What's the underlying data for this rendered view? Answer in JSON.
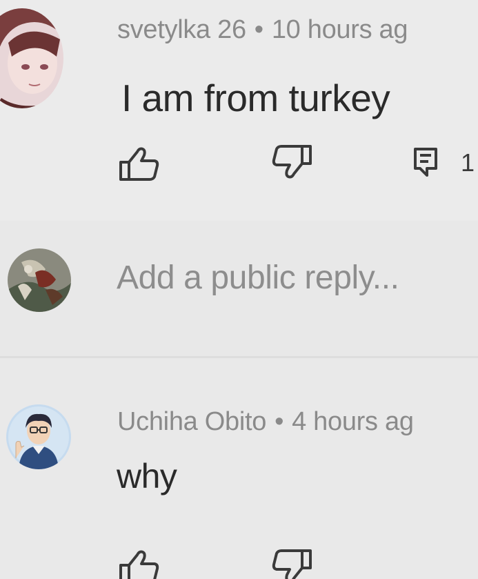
{
  "comment": {
    "author": "svetylka 26",
    "separator": "•",
    "time": "10 hours ag",
    "text": "I am from turkey",
    "reply_count": "1",
    "icons": {
      "like": "thumbs-up-icon",
      "dislike": "thumbs-down-icon",
      "reply": "reply-comment-icon"
    }
  },
  "reply_box": {
    "placeholder": "Add a public reply..."
  },
  "reply": {
    "author": "Uchiha Obito",
    "separator": "•",
    "time": "4 hours ag",
    "text": "why",
    "icons": {
      "like": "thumbs-up-icon",
      "dislike": "thumbs-down-icon"
    }
  },
  "colors": {
    "background": "#e9e9e9",
    "meta_text": "#8a8a8a",
    "body_text": "#2a2a2a",
    "icon_stroke": "#3a3a3a"
  }
}
